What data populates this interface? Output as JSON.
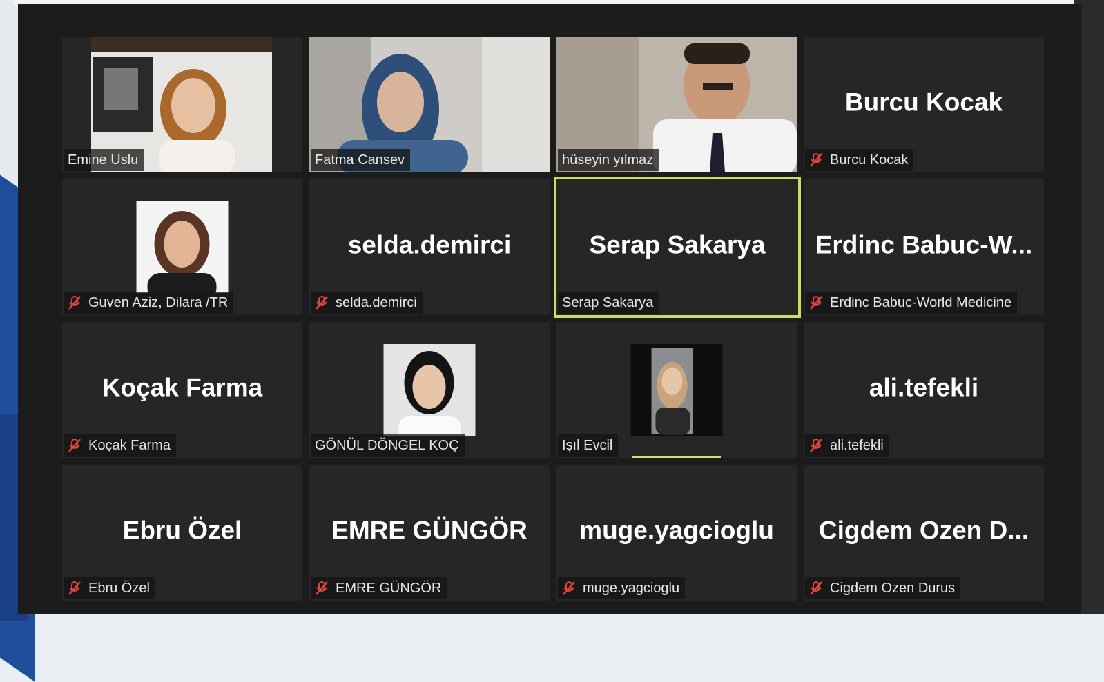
{
  "colors": {
    "active_border": "#c7e062",
    "tile_bg": "#262626",
    "muted_icon": "#e0443c"
  },
  "participants": [
    {
      "label": "Emine Uslu",
      "muted": false,
      "type": "video"
    },
    {
      "label": "Fatma Cansev",
      "muted": false,
      "type": "video"
    },
    {
      "label": "hüseyin yılmaz",
      "muted": false,
      "type": "video"
    },
    {
      "label": "Burcu Kocak",
      "display_name": "Burcu Kocak",
      "muted": true,
      "type": "name"
    },
    {
      "label": "Guven Aziz, Dilara /TR",
      "muted": true,
      "type": "photo"
    },
    {
      "label": "selda.demirci",
      "display_name": "selda.demirci",
      "muted": true,
      "type": "name"
    },
    {
      "label": "Serap Sakarya",
      "display_name": "Serap Sakarya",
      "muted": false,
      "type": "name",
      "active": true
    },
    {
      "label": "Erdinc Babuc-World Medicine",
      "display_name": "Erdinc  Babuc-W...",
      "muted": true,
      "type": "name"
    },
    {
      "label": "Koçak Farma",
      "display_name": "Koçak Farma",
      "muted": true,
      "type": "name"
    },
    {
      "label": "GÖNÜL DÖNGEL KOÇ",
      "muted": false,
      "type": "photo"
    },
    {
      "label": "Işıl Evcil",
      "muted": false,
      "type": "photo"
    },
    {
      "label": "ali.tefekli",
      "display_name": "ali.tefekli",
      "muted": true,
      "type": "name"
    },
    {
      "label": "Ebru Özel",
      "display_name": "Ebru Özel",
      "muted": true,
      "type": "name"
    },
    {
      "label": "EMRE GÜNGÖR",
      "display_name": "EMRE GÜNGÖR",
      "muted": true,
      "type": "name"
    },
    {
      "label": "muge.yagcioglu",
      "display_name": "muge.yagcioglu",
      "muted": true,
      "type": "name"
    },
    {
      "label": "Cigdem Ozen Durus",
      "display_name": "Cigdem  Ozen  D...",
      "muted": true,
      "type": "name"
    }
  ]
}
